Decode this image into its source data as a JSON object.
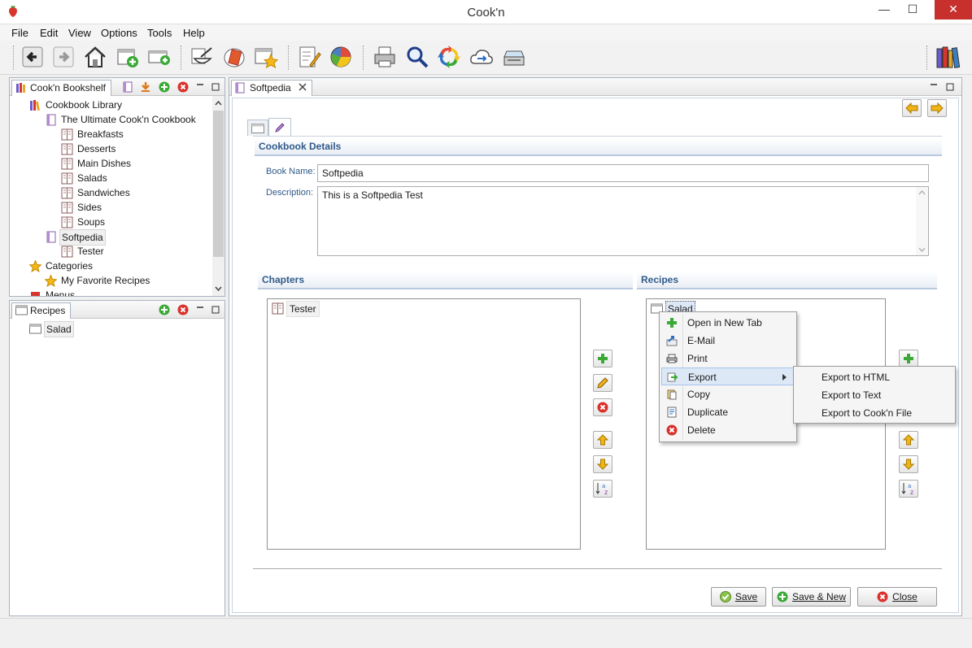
{
  "window": {
    "title": "Cook'n",
    "minimize": "—",
    "maximize": "☐",
    "close": "✕"
  },
  "menu": [
    "File",
    "Edit",
    "View",
    "Options",
    "Tools",
    "Help"
  ],
  "bookshelf": {
    "tab_label": "Cook'n Bookshelf",
    "tree": [
      {
        "label": "Cookbook Library",
        "level": 0,
        "icon": "library"
      },
      {
        "label": "The Ultimate Cook'n Cookbook",
        "level": 1,
        "icon": "book"
      },
      {
        "label": "Breakfasts",
        "level": 2,
        "icon": "chapter"
      },
      {
        "label": "Desserts",
        "level": 2,
        "icon": "chapter"
      },
      {
        "label": "Main Dishes",
        "level": 2,
        "icon": "chapter"
      },
      {
        "label": "Salads",
        "level": 2,
        "icon": "chapter"
      },
      {
        "label": "Sandwiches",
        "level": 2,
        "icon": "chapter"
      },
      {
        "label": "Sides",
        "level": 2,
        "icon": "chapter"
      },
      {
        "label": "Soups",
        "level": 2,
        "icon": "chapter"
      },
      {
        "label": "Softpedia",
        "level": 1,
        "icon": "book",
        "selected": true
      },
      {
        "label": "Tester",
        "level": 2,
        "icon": "chapter"
      },
      {
        "label": "Categories",
        "level": 0,
        "icon": "star"
      },
      {
        "label": "My Favorite Recipes",
        "level": 1,
        "icon": "star"
      },
      {
        "label": "Menus",
        "level": 0,
        "icon": "menu"
      }
    ]
  },
  "recipes_panel": {
    "tab_label": "Recipes",
    "items": [
      "Salad"
    ]
  },
  "editor": {
    "tab_label": "Softpedia",
    "details_header": "Cookbook Details",
    "book_name_label": "Book Name:",
    "book_name_value": "Softpedia",
    "description_label": "Description:",
    "description_value": "This is a Softpedia Test",
    "chapters_header": "Chapters",
    "chapters": [
      "Tester"
    ],
    "recipes_header": "Recipes",
    "recipes": [
      "Salad"
    ],
    "save_label": "Save",
    "save_new_label": "Save & New",
    "close_label": "Close"
  },
  "context_menu": {
    "items": [
      {
        "label": "Open in New Tab",
        "icon": "plus"
      },
      {
        "label": "E-Mail",
        "icon": "email"
      },
      {
        "label": "Print",
        "icon": "print"
      },
      {
        "label": "Export",
        "icon": "export",
        "submenu": true,
        "highlighted": true
      },
      {
        "label": "Copy",
        "icon": "copy"
      },
      {
        "label": "Duplicate",
        "icon": "duplicate"
      },
      {
        "label": "Delete",
        "icon": "delete"
      }
    ],
    "submenu": [
      "Export to HTML",
      "Export to Text",
      "Export to Cook'n File"
    ]
  },
  "colors": {
    "accent": "#2f5a8a",
    "add_green": "#3aa935",
    "delete_red": "#d9312b",
    "arrow_yellow": "#f0b418"
  }
}
